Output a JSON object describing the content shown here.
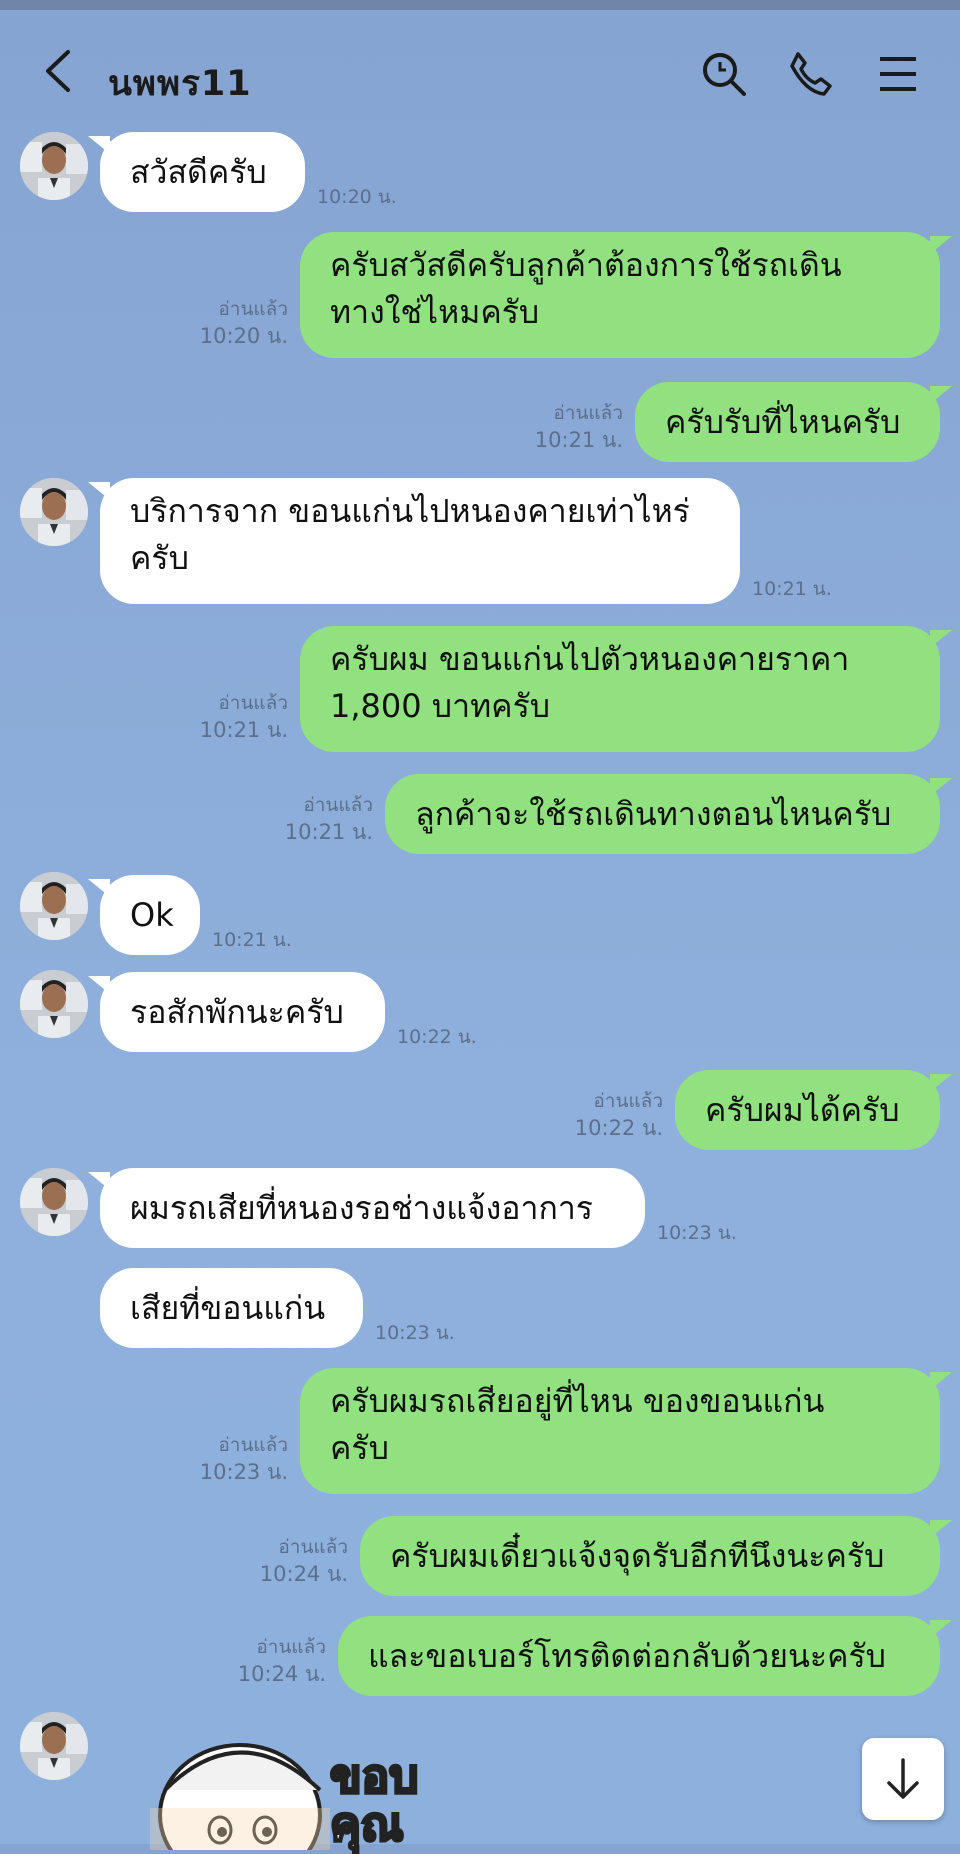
{
  "header": {
    "title": "นพพร11",
    "icons": [
      "back-arrow-icon",
      "search-icon",
      "phone-icon",
      "menu-icon"
    ]
  },
  "messages": [
    {
      "id": "m1",
      "dir": "in",
      "avatar": true,
      "text": "สวัสดีครับ",
      "time": "10:20 น."
    },
    {
      "id": "m2",
      "dir": "out",
      "lines": [
        "ครับสวัสดีครับลูกค้าต้องการใช้รถเดิน",
        "ทางใช่ไหมครับ"
      ],
      "read": "อ่านแล้ว",
      "time": "10:20 น."
    },
    {
      "id": "m3",
      "dir": "out",
      "text": "ครับรับที่ไหนครับ",
      "read": "อ่านแล้ว",
      "time": "10:21 น."
    },
    {
      "id": "m4",
      "dir": "in",
      "avatar": true,
      "lines": [
        "บริการจาก ขอนแก่นไปหนองคายเท่าไหร่",
        "ครับ"
      ],
      "time": "10:21 น."
    },
    {
      "id": "m5",
      "dir": "out",
      "lines": [
        "ครับผม ขอนแก่นไปตัวหนองคายราคา",
        "1,800 บาทครับ"
      ],
      "read": "อ่านแล้ว",
      "time": "10:21 น."
    },
    {
      "id": "m6",
      "dir": "out",
      "text": "ลูกค้าจะใช้รถเดินทางตอนไหนครับ",
      "read": "อ่านแล้ว",
      "time": "10:21 น."
    },
    {
      "id": "m7",
      "dir": "in",
      "avatar": true,
      "text": "Ok",
      "time": "10:21 น."
    },
    {
      "id": "m8",
      "dir": "in",
      "avatar": true,
      "text": "รอสักพักนะครับ",
      "time": "10:22 น."
    },
    {
      "id": "m9",
      "dir": "out",
      "text": "ครับผมได้ครับ",
      "read": "อ่านแล้ว",
      "time": "10:22 น."
    },
    {
      "id": "m10",
      "dir": "in",
      "avatar": true,
      "text": "ผมรถเสียที่หนองรอช่างแจ้งอาการ",
      "time": "10:23 น."
    },
    {
      "id": "m11",
      "dir": "in",
      "avatar": false,
      "text": "เสียที่ขอนแก่น",
      "time": "10:23 น."
    },
    {
      "id": "m12",
      "dir": "out",
      "lines": [
        "ครับผมรถเสียอยู่ที่ไหน ของขอนแก่น",
        "ครับ"
      ],
      "read": "อ่านแล้ว",
      "time": "10:23 น."
    },
    {
      "id": "m13",
      "dir": "out",
      "text": "ครับผมเดี๋ยวแจ้งจุดรับอีกทีนึงนะครับ",
      "read": "อ่านแล้ว",
      "time": "10:24 น."
    },
    {
      "id": "m14",
      "dir": "out",
      "text": "และขอเบอร์โทรติดต่อกลับด้วยนะครับ",
      "read": "อ่านแล้ว",
      "time": "10:24 น."
    }
  ],
  "sticker": {
    "text_lines": [
      "ขอบ",
      "คุณ"
    ]
  },
  "colors": {
    "background": "#8aa9d6",
    "outgoing": "#92e180",
    "incoming": "#ffffff"
  }
}
